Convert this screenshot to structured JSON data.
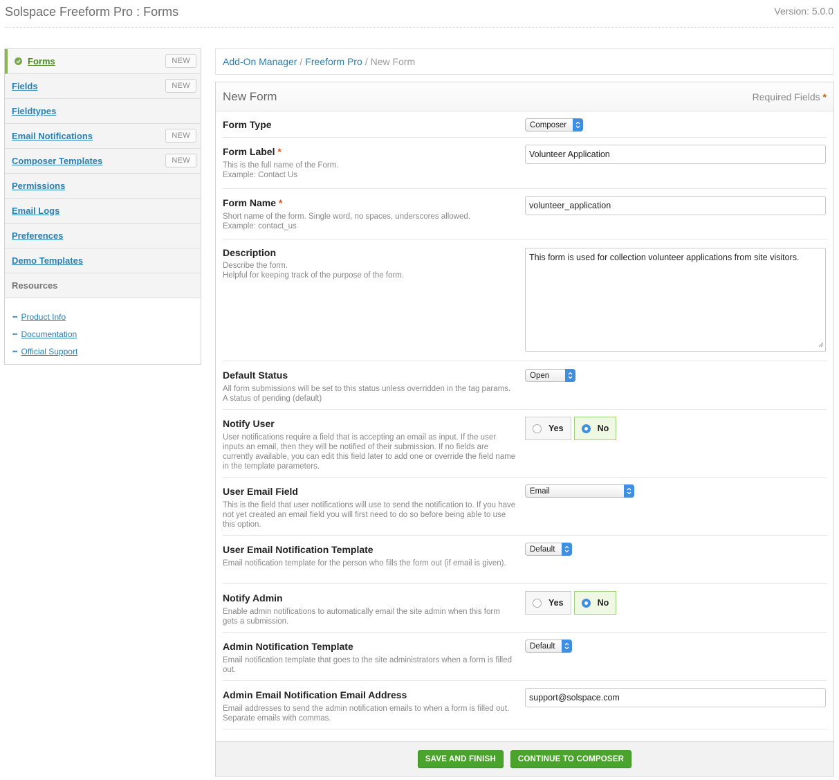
{
  "header": {
    "title": "Solspace Freeform Pro : Forms",
    "version": "Version: 5.0.0"
  },
  "sidebar": {
    "items": [
      {
        "label": "Forms",
        "badge": "NEW",
        "active": true
      },
      {
        "label": "Fields",
        "badge": "NEW"
      },
      {
        "label": "Fieldtypes",
        "badge": ""
      },
      {
        "label": "Email Notifications",
        "badge": "NEW"
      },
      {
        "label": "Composer Templates",
        "badge": "NEW"
      },
      {
        "label": "Permissions",
        "badge": ""
      },
      {
        "label": "Email Logs",
        "badge": ""
      },
      {
        "label": "Preferences",
        "badge": ""
      },
      {
        "label": "Demo Templates",
        "badge": ""
      }
    ],
    "resources_heading": "Resources",
    "resources": [
      {
        "label": "Product Info"
      },
      {
        "label": "Documentation"
      },
      {
        "label": "Official Support"
      }
    ]
  },
  "breadcrumb": {
    "items": [
      "Add-On Manager",
      "Freeform Pro"
    ],
    "separator": "/",
    "current": "New Form"
  },
  "form": {
    "title": "New Form",
    "required_label": "Required Fields",
    "required_mark": "*",
    "form_type": {
      "label": "Form Type",
      "value": "Composer"
    },
    "form_label": {
      "label": "Form Label",
      "desc1": "This is the full name of the Form.",
      "desc2": "Example: Contact Us",
      "value": "Volunteer Application"
    },
    "form_name": {
      "label": "Form Name",
      "desc1": "Short name of the form. Single word, no spaces, underscores allowed.",
      "desc2": "Example: contact_us",
      "value": "volunteer_application"
    },
    "description": {
      "label": "Description",
      "desc1": "Describe the form.",
      "desc2": "Helpful for keeping track of the purpose of the form.",
      "value": "This form is used for collection volunteer applications from site visitors."
    },
    "default_status": {
      "label": "Default Status",
      "desc": "All form submissions will be set to this status unless overridden in the tag params. A status of pending (default)",
      "value": "Open"
    },
    "notify_user": {
      "label": "Notify User",
      "desc": "User notifications require a field that is accepting an email as input. If the user inputs an email, then they will be notified of their submission. If no fields are currently available, you can edit this field later to add one or override the field name in the template parameters.",
      "yes": "Yes",
      "no": "No",
      "selected": "No"
    },
    "user_email_field": {
      "label": "User Email Field",
      "desc": "This is the field that user notifications will use to send the notification to. If you have not yet created an email field you will first need to do so before being able to use this option.",
      "value": "Email"
    },
    "user_email_template": {
      "label": "User Email Notification Template",
      "desc": "Email notification template for the person who fills the form out (if email is given).",
      "value": "Default"
    },
    "notify_admin": {
      "label": "Notify Admin",
      "desc": "Enable admin notifications to automatically email the site admin when this form gets a submission.",
      "yes": "Yes",
      "no": "No",
      "selected": "No"
    },
    "admin_template": {
      "label": "Admin Notification Template",
      "desc": "Email notification template that goes to the site administrators when a form is filled out.",
      "value": "Default"
    },
    "admin_email": {
      "label": "Admin Email Notification Email Address",
      "desc": "Email addresses to send the admin notification emails to when a form is filled out. Separate emails with commas.",
      "value": "support@solspace.com"
    }
  },
  "buttons": {
    "save_finish": "SAVE AND FINISH",
    "continue_composer": "CONTINUE TO COMPOSER"
  },
  "colors": {
    "link": "#2a7fb3",
    "accent_green": "#4aa32b",
    "required": "#e0501c",
    "select_arrow": "#3f8ee0"
  }
}
